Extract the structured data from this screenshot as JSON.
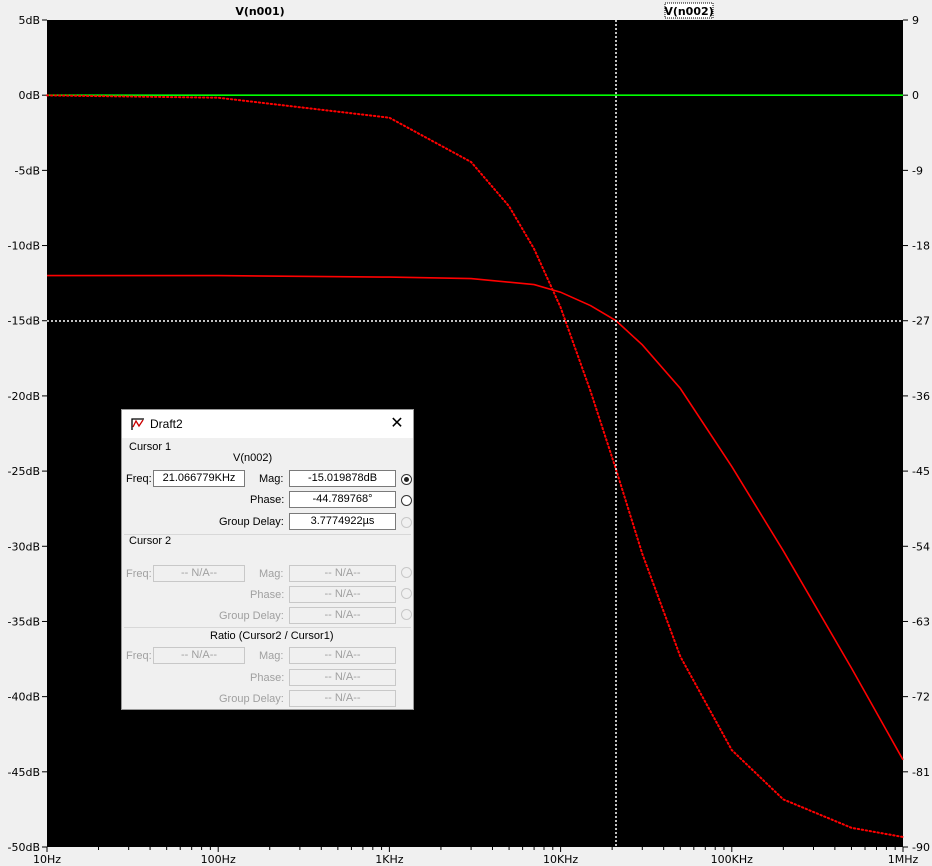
{
  "plot": {
    "trace_labels": [
      "V(n001)",
      "V(n002)"
    ],
    "trace_colors": [
      "#00ff00",
      "#ff0000"
    ],
    "background": "#000000",
    "cursor_color": "#ffffff"
  },
  "chart_data": {
    "type": "line",
    "x_scale": "log",
    "x_unit": "Hz",
    "xlim": [
      10,
      1000000
    ],
    "x_ticks": [
      "10Hz",
      "100Hz",
      "1KHz",
      "10KHz",
      "100KHz",
      "1MHz"
    ],
    "y_left_lim": [
      -50,
      5
    ],
    "y_left_ticks": [
      "5dB",
      "0dB",
      "-5dB",
      "-10dB",
      "-15dB",
      "-20dB",
      "-25dB",
      "-30dB",
      "-35dB",
      "-40dB",
      "-45dB",
      "-50dB"
    ],
    "y_right_lim": [
      -90,
      9
    ],
    "y_right_ticks": [
      "9",
      "0",
      "-9",
      "-18",
      "-27",
      "-36",
      "-45",
      "-54",
      "-63",
      "-72",
      "-81",
      "-90"
    ],
    "series": [
      {
        "name": "V(n001)",
        "color": "#00ff00",
        "style": "solid",
        "x": [
          10,
          1000000
        ],
        "y": [
          0,
          0
        ]
      },
      {
        "name": "V(n002)",
        "color": "#ff0000",
        "style": "solid",
        "axis": "left",
        "x": [
          10,
          100,
          1000,
          3000,
          7000,
          10000,
          15000,
          21067,
          30000,
          50000,
          100000,
          200000,
          500000,
          1000000
        ],
        "y": [
          -12,
          -12,
          -12.1,
          -12.2,
          -12.6,
          -13.1,
          -14,
          -15,
          -16.6,
          -19.5,
          -24.7,
          -30.3,
          -38.1,
          -44.2
        ]
      },
      {
        "name": "V(n002)",
        "color": "#ff0000",
        "style": "dotted",
        "axis": "right",
        "x": [
          10,
          100,
          1000,
          3000,
          5000,
          7000,
          10000,
          15000,
          21067,
          30000,
          50000,
          100000,
          200000,
          500000,
          1000000
        ],
        "y": [
          -0.03,
          -0.3,
          -2.7,
          -8,
          -13.3,
          -18.4,
          -25.4,
          -35.5,
          -44.8,
          -54.9,
          -67.2,
          -78.4,
          -84.3,
          -87.7,
          -88.8
        ]
      }
    ],
    "cursor": {
      "x": 21066.779,
      "y": -15.019878
    }
  },
  "dialog": {
    "title": "Draft2",
    "close_icon": "close-icon",
    "cursor1": {
      "section": "Cursor 1",
      "trace": "V(n002)",
      "freq_label": "Freq:",
      "freq": "21.066779KHz",
      "mag_label": "Mag:",
      "mag": "-15.019878dB",
      "phase_label": "Phase:",
      "phase": "-44.789768°",
      "gd_label": "Group Delay:",
      "gd": "3.7774922µs"
    },
    "cursor2": {
      "section": "Cursor 2",
      "freq_label": "Freq:",
      "freq": "-- N/A--",
      "mag_label": "Mag:",
      "mag": "-- N/A--",
      "phase_label": "Phase:",
      "phase": "-- N/A--",
      "gd_label": "Group Delay:",
      "gd": "-- N/A--"
    },
    "ratio": {
      "section": "Ratio (Cursor2 / Cursor1)",
      "freq_label": "Freq:",
      "freq": "-- N/A--",
      "mag_label": "Mag:",
      "mag": "-- N/A--",
      "phase_label": "Phase:",
      "phase": "-- N/A--",
      "gd_label": "Group Delay:",
      "gd": "-- N/A--"
    }
  }
}
